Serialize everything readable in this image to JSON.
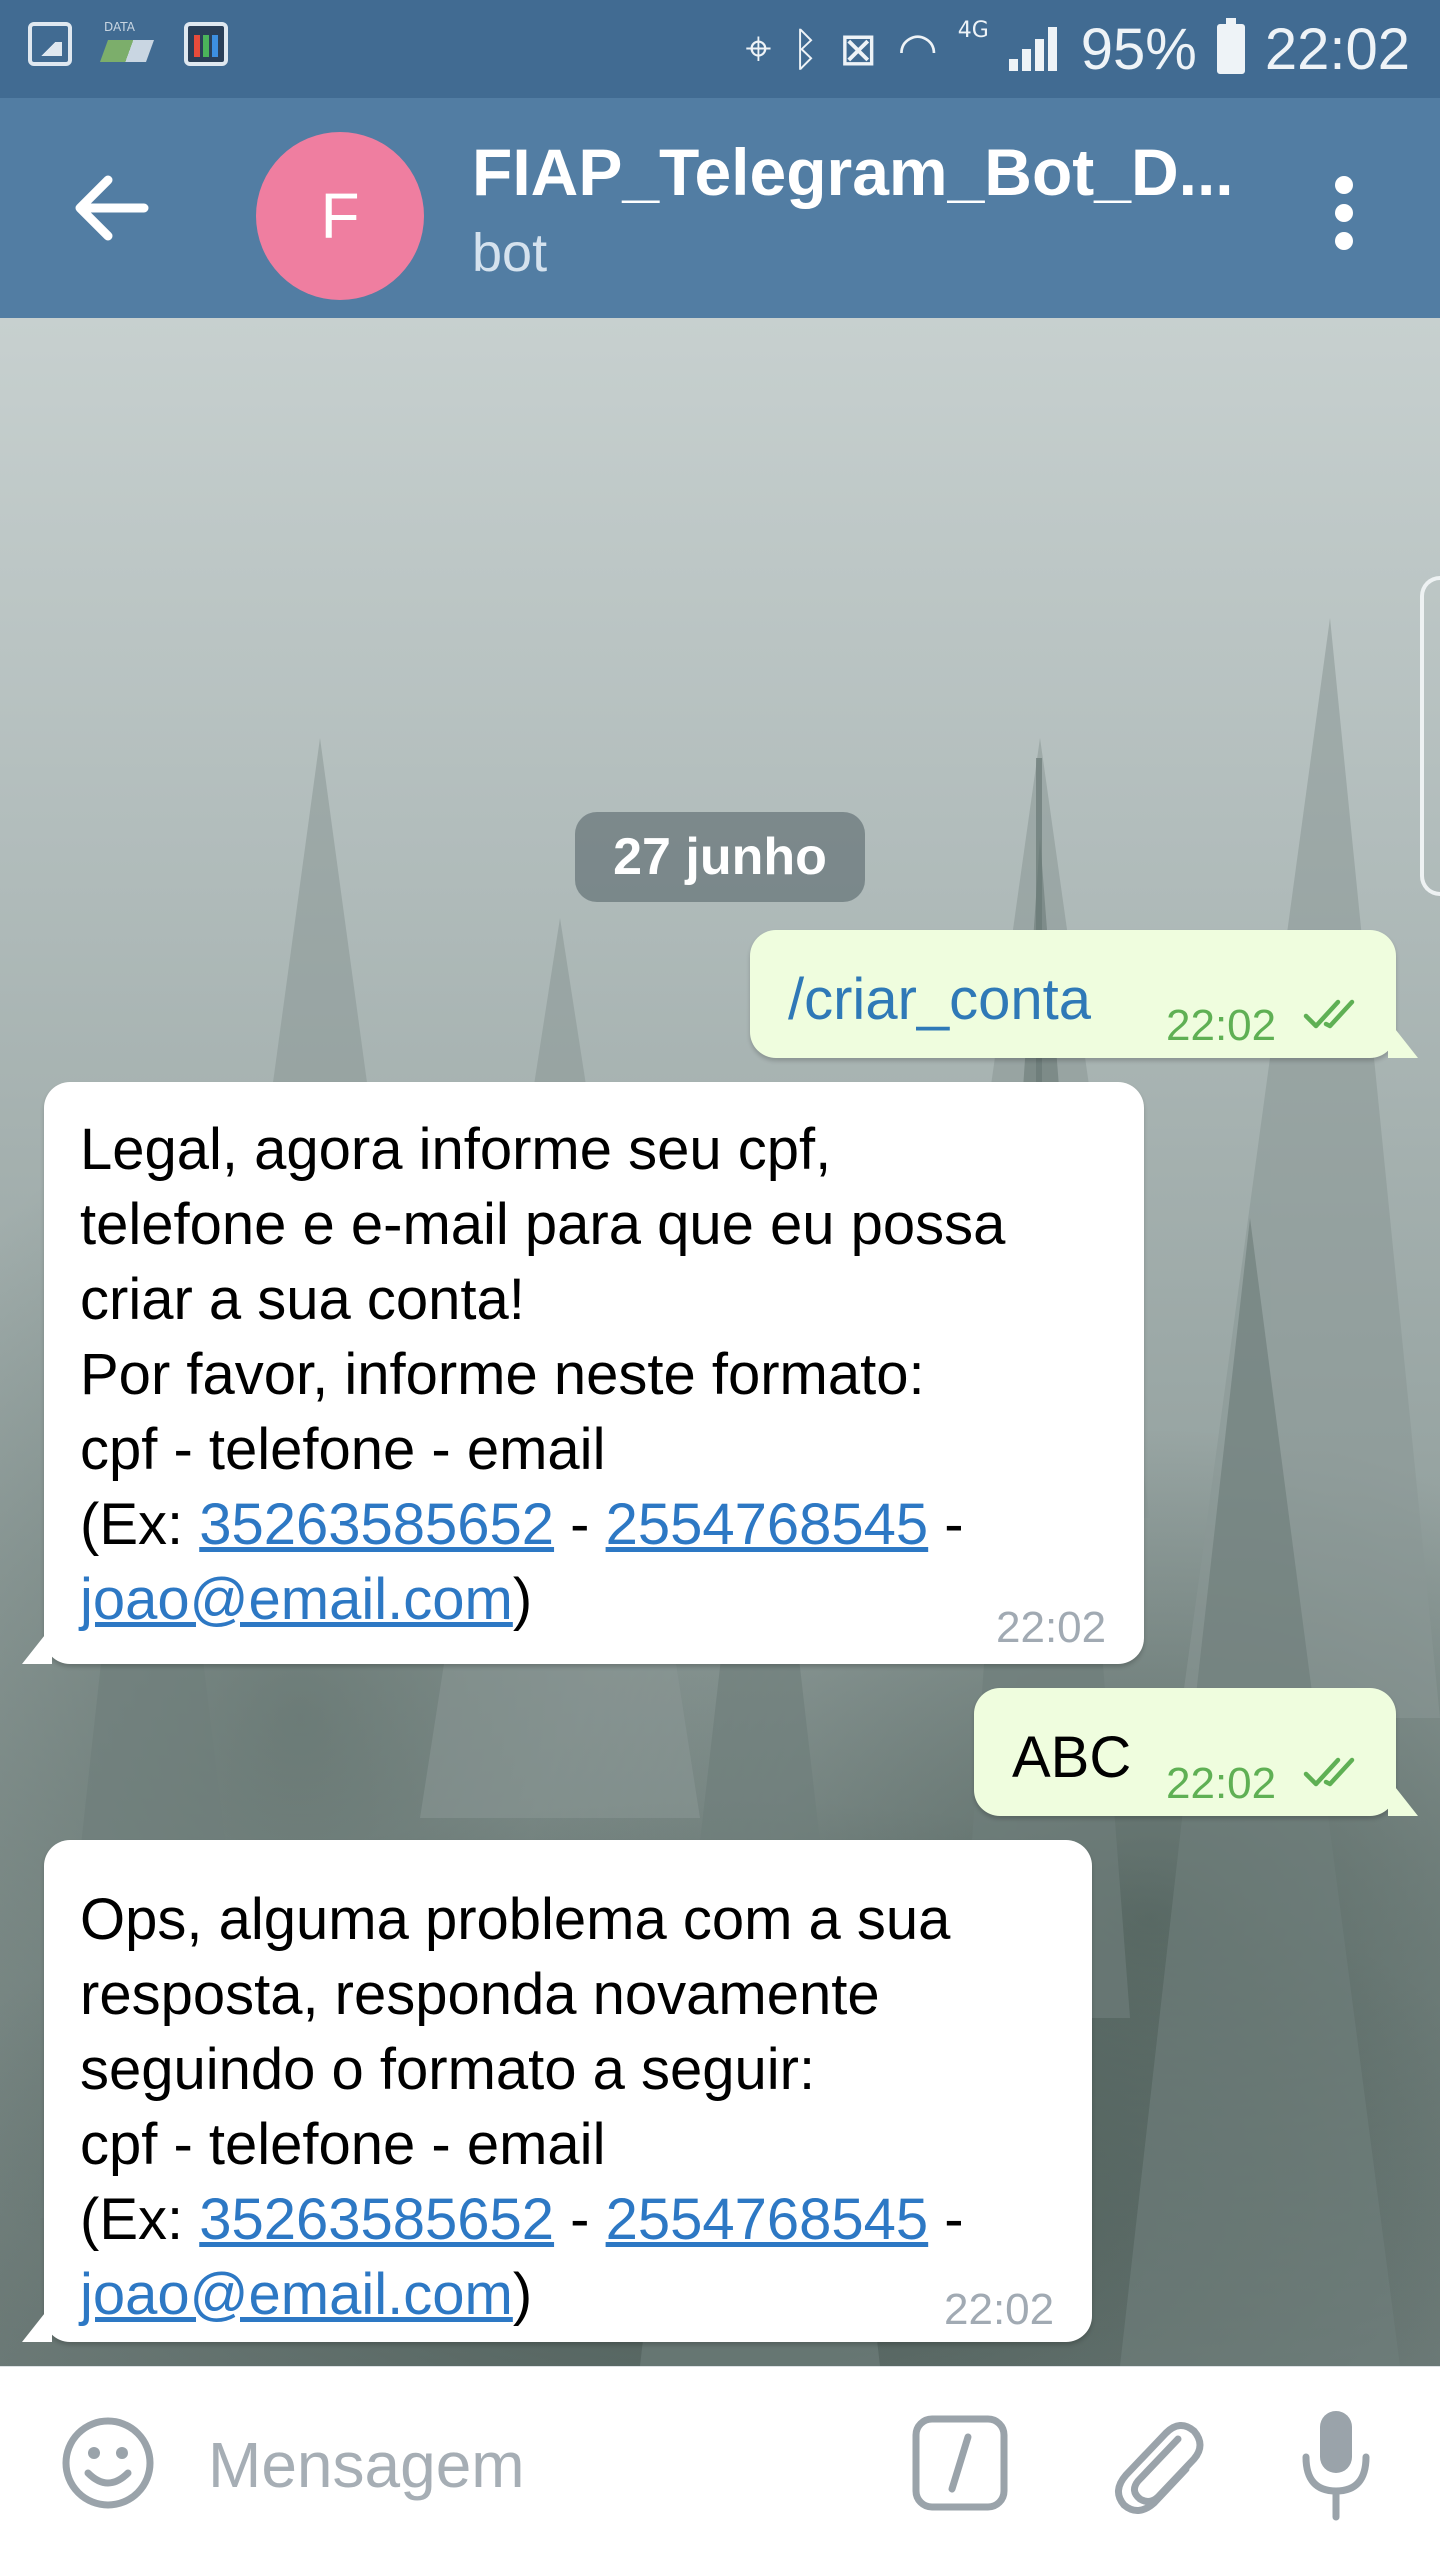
{
  "status_bar": {
    "data_label": "DATA",
    "network": "4G",
    "battery": "95%",
    "time": "22:02"
  },
  "header": {
    "avatar_letter": "F",
    "title": "FIAP_Telegram_Bot_D...",
    "subtitle": "bot"
  },
  "chat": {
    "date_label": "27 junho",
    "messages": [
      {
        "direction": "out",
        "text": "/criar_conta",
        "time": "22:02"
      },
      {
        "direction": "in",
        "text_intro": "Legal, agora informe seu cpf,\ntelefone e e-mail para que eu possa\ncriar a sua conta!\nPor favor, informe neste formato:\ncpf - telefone - email\n(Ex: ",
        "link_cpf": "35263585652",
        "sep1": " - ",
        "link_phone": "2554768545",
        "sep2": " -\n",
        "link_email": "joao@email.com",
        "text_end": ")",
        "time": "22:02"
      },
      {
        "direction": "out",
        "text": "ABC",
        "time": "22:02"
      },
      {
        "direction": "in",
        "text_intro": "Ops, alguma problema com a sua\nresposta, responda novamente\nseguindo o formato a seguir:\ncpf - telefone - email\n(Ex: ",
        "link_cpf": "35263585652",
        "sep1": " - ",
        "link_phone": "2554768545",
        "sep2": " -\n",
        "link_email": "joao@email.com",
        "text_end": ")",
        "time": "22:02"
      }
    ]
  },
  "input_bar": {
    "placeholder": "Mensagem"
  },
  "colors": {
    "header": "#527da3",
    "status_bar": "#416b92",
    "outgoing_bubble": "#effdde",
    "incoming_bubble": "#ffffff",
    "link": "#2d78c4",
    "read_ticks": "#5fb054"
  },
  "icons": [
    "back-arrow-icon",
    "more-vertical-icon",
    "emoji-icon",
    "bot-command-icon",
    "paperclip-icon",
    "microphone-icon",
    "double-check-icon"
  ]
}
